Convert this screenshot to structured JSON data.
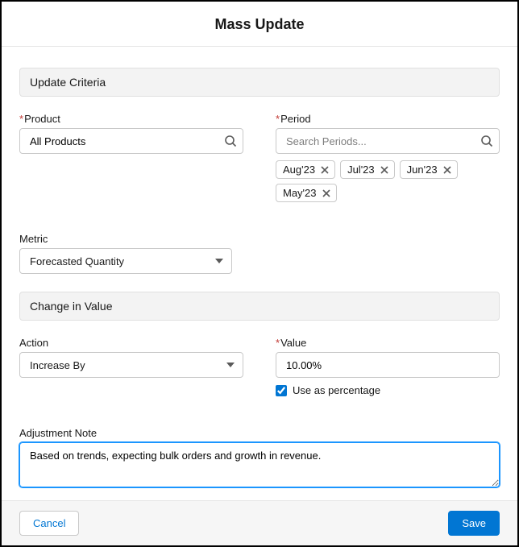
{
  "header": {
    "title": "Mass Update"
  },
  "sections": {
    "criteria": "Update Criteria",
    "change": "Change in Value"
  },
  "product": {
    "label": "Product",
    "value": "All Products"
  },
  "period": {
    "label": "Period",
    "placeholder": "Search Periods...",
    "chips": [
      "Aug'23",
      "Jul'23",
      "Jun'23",
      "May'23"
    ]
  },
  "metric": {
    "label": "Metric",
    "value": "Forecasted Quantity"
  },
  "action": {
    "label": "Action",
    "value": "Increase By"
  },
  "value": {
    "label": "Value",
    "value": "10.00%",
    "checkbox_label": "Use as percentage",
    "checkbox_checked": true
  },
  "note": {
    "label": "Adjustment Note",
    "value": "Based on trends, expecting bulk orders and growth in revenue."
  },
  "footer": {
    "cancel": "Cancel",
    "save": "Save"
  }
}
